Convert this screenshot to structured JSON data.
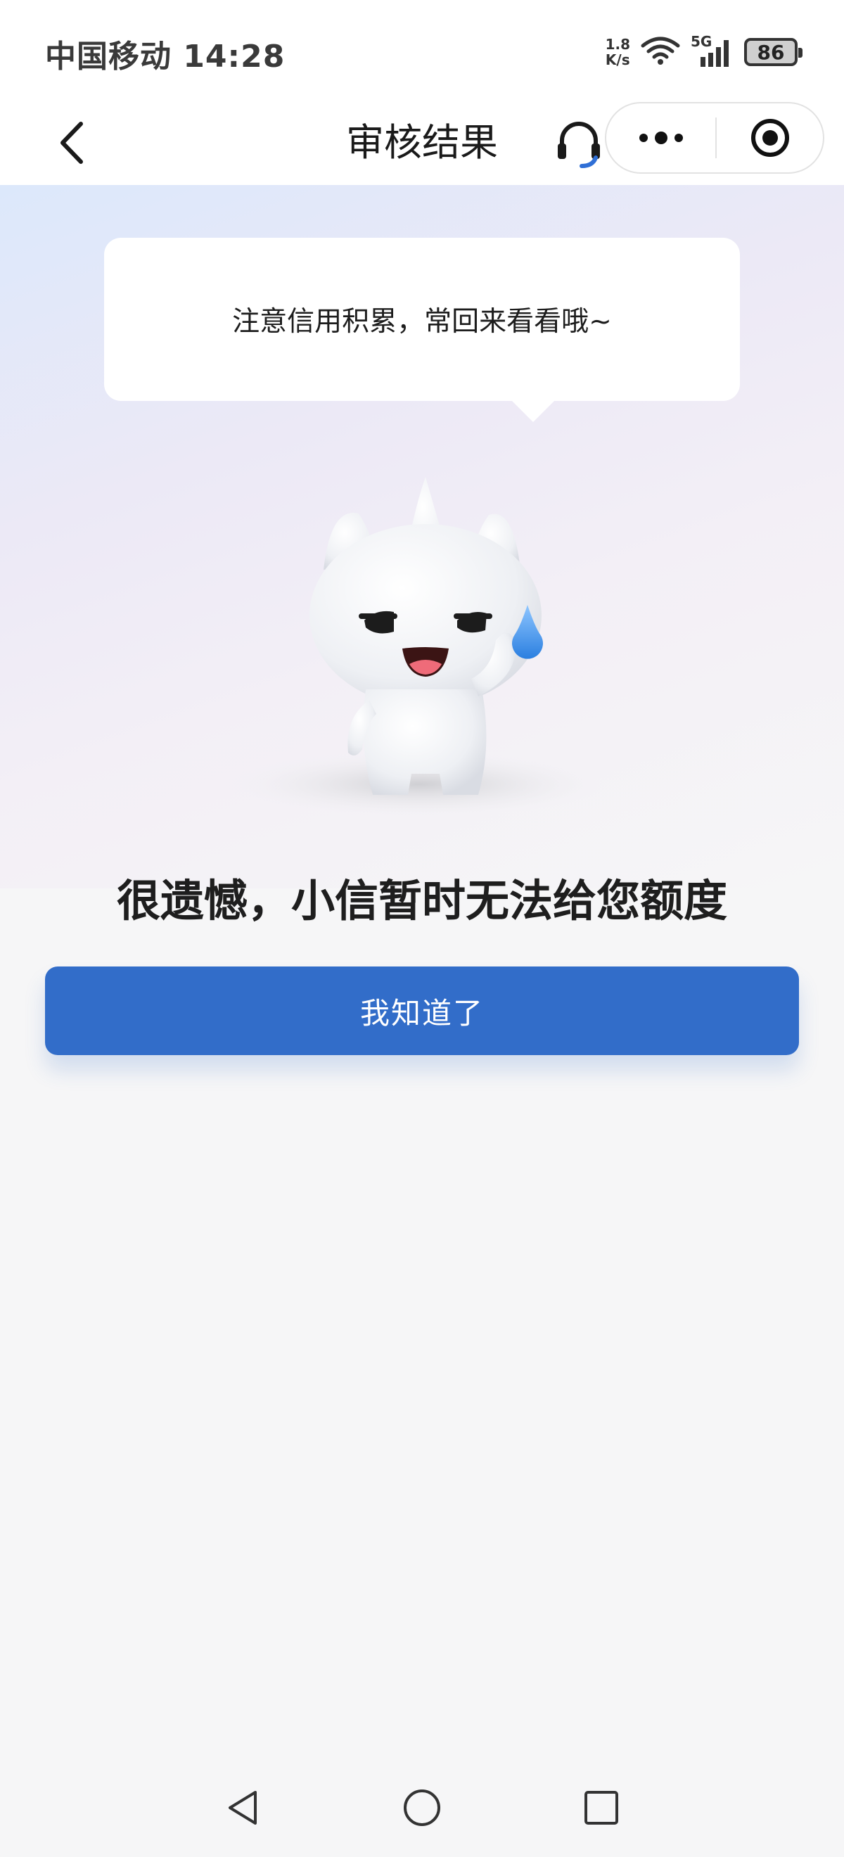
{
  "status_bar": {
    "carrier_time": "中国移动 14:28",
    "net_speed_value": "1.8",
    "net_speed_unit": "K/s",
    "network_type": "5G",
    "battery_level": "86"
  },
  "nav": {
    "title": "审核结果"
  },
  "bubble": {
    "text": "注意信用积累，常回来看看哦~"
  },
  "result": {
    "title": "很遗憾，小信暂时无法给您额度"
  },
  "button": {
    "label": "我知道了"
  },
  "colors": {
    "primary": "#326dc9",
    "headset_accent": "#2f6fd6",
    "sweat_drop": "#3d8fe8"
  },
  "icons": [
    "back-arrow-icon",
    "headset-icon",
    "more-icon",
    "close-target-icon",
    "nav-back-icon",
    "nav-home-icon",
    "nav-recents-icon"
  ]
}
